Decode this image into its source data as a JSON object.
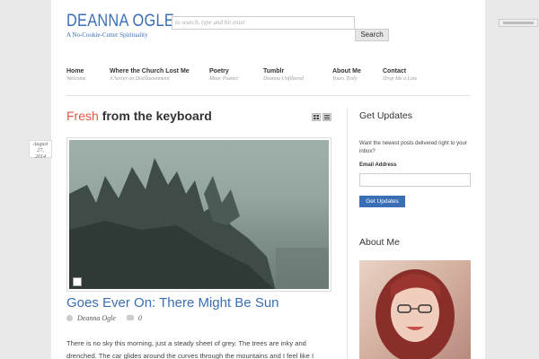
{
  "header": {
    "site_title": "DEANNA OGLE",
    "tagline": "A No-Cookie-Cutter Spirituality",
    "search_placeholder": "to search, type and hit enter",
    "search_button": "Search"
  },
  "nav": [
    {
      "label": "Home",
      "sub": "Welcome"
    },
    {
      "label": "Where the Church Lost Me",
      "sub": "A Series on Disillusionment"
    },
    {
      "label": "Poetry",
      "sub": "Moar Poems!"
    },
    {
      "label": "Tumblr",
      "sub": "Deanna Unfiltered"
    },
    {
      "label": "About Me",
      "sub": "Yours Truly"
    },
    {
      "label": "Contact",
      "sub": "Drop Me a Line"
    }
  ],
  "main": {
    "heading_accent": "Fresh",
    "heading_rest": "from the keyboard",
    "post": {
      "date_month": "August",
      "date_day": "27,",
      "date_year": "2014",
      "title": "Goes Ever On: There Might Be Sun",
      "author": "Deanna Ogle",
      "comments": "0",
      "excerpt": "There is no sky this morning, just a steady sheet of grey. The trees are inky and drenched. The car glides around the curves through the mountains and I feel like I"
    }
  },
  "sidebar": {
    "updates_heading": "Get Updates",
    "updates_text": "Want the newest posts delivered right to your inbox?",
    "email_label": "Email Address",
    "updates_button": "Get Updates",
    "about_heading": "About Me"
  },
  "colors": {
    "accent": "#e05a42",
    "link": "#3a6fb5"
  },
  "icons": [
    "grid-view-icon",
    "list-view-icon",
    "author-icon",
    "comment-icon",
    "image-format-icon"
  ]
}
